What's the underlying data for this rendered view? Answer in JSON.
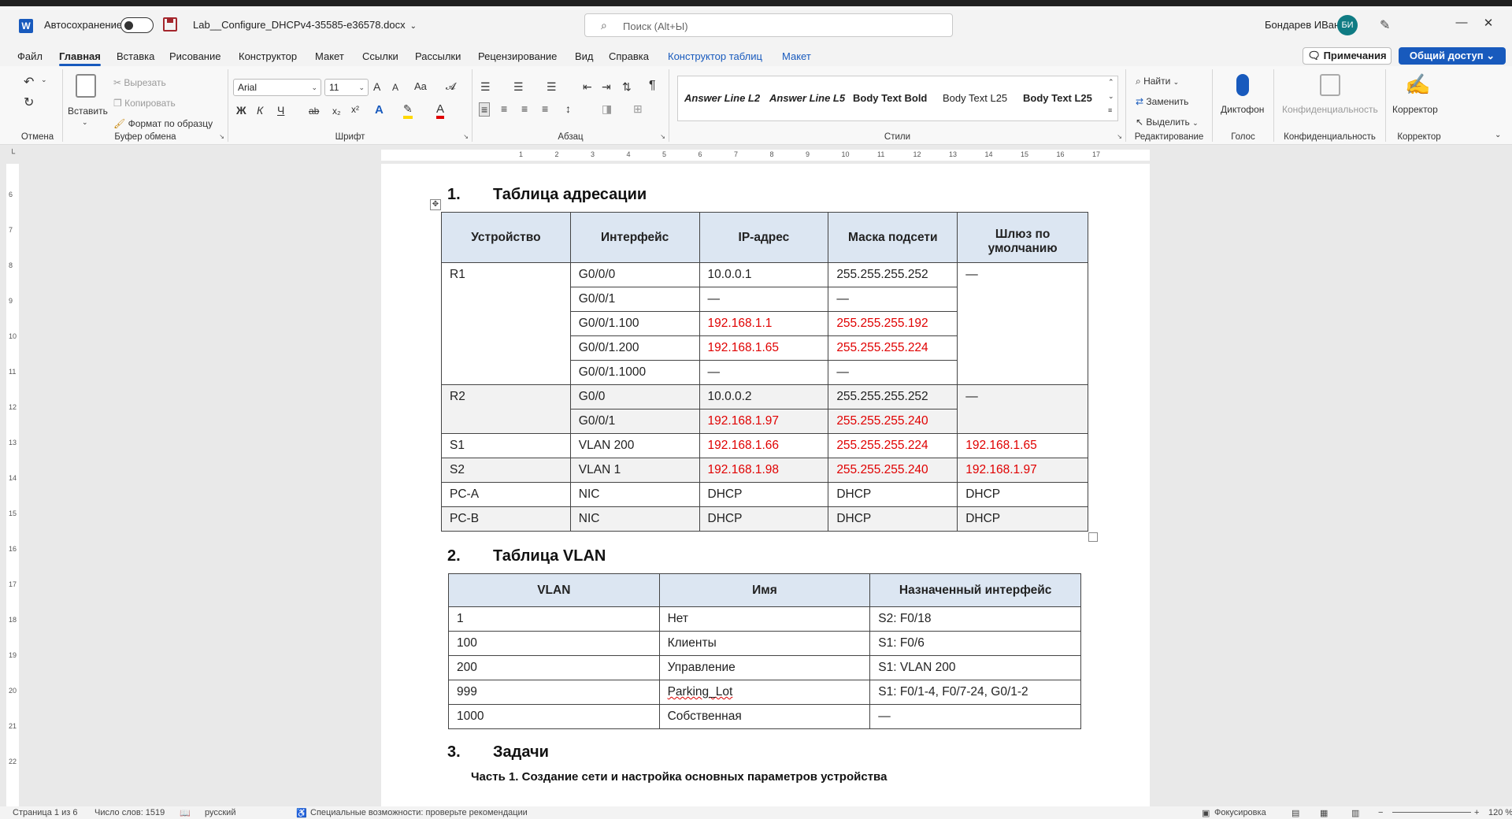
{
  "titlebar": {
    "autosave_label": "Автосохранение",
    "doc_title": "Lab__Configure_DHCPv4-35585-e36578.docx",
    "search_placeholder": "Поиск (Alt+Ы)",
    "user_name": "Бондарев ИВан",
    "avatar_initials": "БИ",
    "app_icon_letter": "W"
  },
  "menu": {
    "tabs": [
      "Файл",
      "Главная",
      "Вставка",
      "Рисование",
      "Конструктор",
      "Макет",
      "Ссылки",
      "Рассылки",
      "Рецензирование",
      "Вид",
      "Справка",
      "Конструктор таблиц",
      "Макет"
    ],
    "notes_label": "Примечания",
    "share_label": "Общий доступ"
  },
  "ribbon": {
    "undo_group": "Отмена",
    "clipboard": {
      "paste": "Вставить",
      "cut": "Вырезать",
      "copy": "Копировать",
      "format_painter": "Формат по образцу",
      "group": "Буфер обмена"
    },
    "font": {
      "name": "Arial",
      "size": "11",
      "group": "Шрифт",
      "case_label": "Aa",
      "grow_label": "A",
      "shrink_label": "A",
      "bold": "Ж",
      "italic": "К",
      "underline": "Ч",
      "strike": "ab",
      "subscript": "x₂",
      "superscript": "x²",
      "effects_label": "A",
      "color_label": "A"
    },
    "paragraph": {
      "group": "Абзац",
      "pilcrow": "¶"
    },
    "styles": {
      "items": [
        "Answer Line L2",
        "Answer Line L5",
        "Body Text Bold",
        "Body Text L25",
        "Body Text L25"
      ],
      "group": "Стили"
    },
    "editing": {
      "find": "Найти",
      "replace": "Заменить",
      "select": "Выделить",
      "group": "Редактирование"
    },
    "voice": {
      "dictate": "Диктофон",
      "group": "Голос"
    },
    "privacy": {
      "label": "Конфиденциальность",
      "group": "Конфиденциальность"
    },
    "editor": {
      "label": "Корректор",
      "group": "Корректор"
    }
  },
  "ruler": {
    "horizontal_labels": [
      "1",
      "2",
      "3",
      "4",
      "5",
      "6",
      "7",
      "8",
      "9",
      "10",
      "11",
      "12",
      "13",
      "14",
      "15",
      "16",
      "17"
    ],
    "vertical_labels": [
      "6",
      "7",
      "8",
      "9",
      "10",
      "11",
      "12",
      "13",
      "14",
      "15",
      "16",
      "17",
      "18",
      "19",
      "20",
      "21",
      "22"
    ]
  },
  "document": {
    "section1": {
      "number": "1.",
      "title": "Таблица адресации"
    },
    "addressing_table": {
      "headers": [
        "Устройство",
        "Интерфейс",
        "IP-адрес",
        "Маска подсети",
        "Шлюз по умолчанию"
      ],
      "r1": {
        "device": "R1",
        "gateway": "—",
        "rows": [
          {
            "iface": "G0/0/0",
            "ip": "10.0.0.1",
            "mask": "255.255.255.252"
          },
          {
            "iface": "G0/0/1",
            "ip": "—",
            "mask": "—"
          },
          {
            "iface": "G0/0/1.100",
            "ip": "192.168.1.1",
            "mask": "255.255.255.192"
          },
          {
            "iface": "G0/0/1.200",
            "ip": "192.168.1.65",
            "mask": "255.255.255.224"
          },
          {
            "iface": "G0/0/1.1000",
            "ip": "—",
            "mask": "—"
          }
        ]
      },
      "r2": {
        "device": "R2",
        "gateway": "—",
        "rows": [
          {
            "iface": "G0/0",
            "ip": "10.0.0.2",
            "mask": "255.255.255.252"
          },
          {
            "iface": "G0/0/1",
            "ip": "192.168.1.97",
            "mask": "255.255.255.240"
          }
        ]
      },
      "s1": {
        "device": "S1",
        "iface": "VLAN 200",
        "ip": "192.168.1.66",
        "mask": "255.255.255.224",
        "gateway": "192.168.1.65"
      },
      "s2": {
        "device": "S2",
        "iface": "VLAN 1",
        "ip": "192.168.1.98",
        "mask": "255.255.255.240",
        "gateway": "192.168.1.97"
      },
      "pca": {
        "device": "PC-A",
        "iface": "NIC",
        "ip": "DHCP",
        "mask": "DHCP",
        "gateway": "DHCP"
      },
      "pcb": {
        "device": "PC-B",
        "iface": "NIC",
        "ip": "DHCP",
        "mask": "DHCP",
        "gateway": "DHCP"
      }
    },
    "section2": {
      "number": "2.",
      "title": "Таблица VLAN"
    },
    "vlan_table": {
      "headers": [
        "VLAN",
        "Имя",
        "Назначенный интерфейс"
      ],
      "rows": [
        [
          "1",
          "Нет",
          "S2: F0/18"
        ],
        [
          "100",
          "Клиенты",
          "S1: F0/6"
        ],
        [
          "200",
          "Управление",
          "S1: VLAN 200"
        ],
        [
          "999",
          "Parking_Lot",
          "S1: F0/1-4, F0/7-24, G0/1-2"
        ],
        [
          "1000",
          "Собственная",
          "—"
        ]
      ]
    },
    "section3": {
      "number": "3.",
      "title": "Задачи"
    },
    "part1": "Часть 1. Создание сети и настройка основных параметров устройства"
  },
  "status": {
    "page": "Страница 1 из 6",
    "words": "Число слов: 1519",
    "language": "русский",
    "accessibility": "Специальные возможности: проверьте рекомендации",
    "focus": "Фокусировка",
    "zoom": "120 %"
  },
  "colors": {
    "accent": "#185abd",
    "answer_red": "#e00000",
    "header_fill": "#dce6f2"
  }
}
